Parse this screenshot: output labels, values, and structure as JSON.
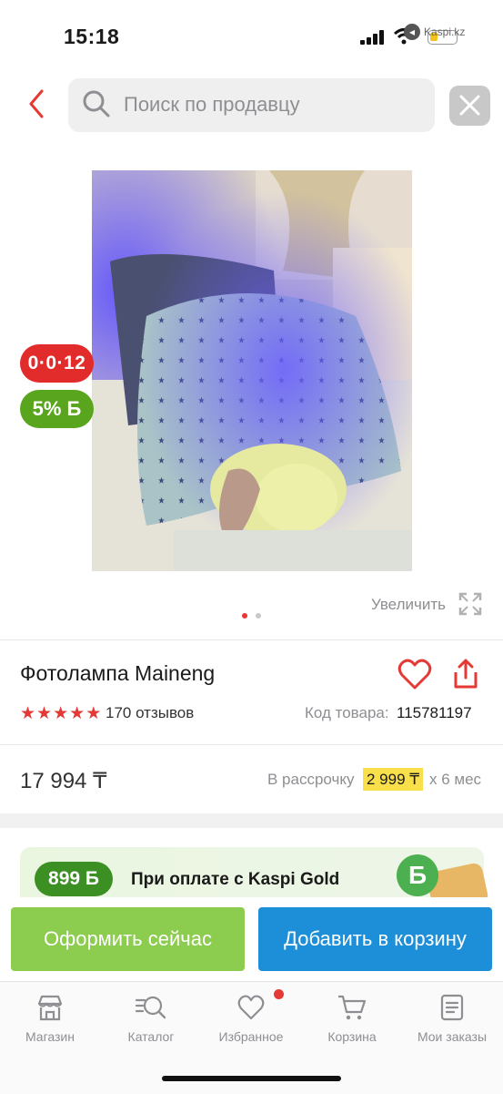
{
  "status_bar": {
    "time": "15:18",
    "source_tag": "Kaspi.kz"
  },
  "search": {
    "placeholder": "Поиск по продавцу"
  },
  "badges": {
    "timer": "0·0·12",
    "bonus": "5% Б"
  },
  "gallery": {
    "enlarge_label": "Увеличить",
    "current_slide": 1,
    "total_slides": 2
  },
  "product": {
    "title": "Фотолампа Maineng",
    "rating": 5,
    "reviews": "170 отзывов",
    "sku_label": "Код товара:",
    "sku_value": "115781197"
  },
  "pricing": {
    "price": "17 994 ₸",
    "installment_label": "В рассрочку",
    "installment_amount": "2 999 ₸",
    "installment_term": "х 6 мес"
  },
  "kaspi_gold": {
    "bonus": "899 Б",
    "text": "При оплате с Kaspi Gold",
    "coin": "Б"
  },
  "actions": {
    "buy_now": "Оформить сейчас",
    "add_to_cart": "Добавить в корзину"
  },
  "tabs": [
    {
      "label": "Магазин",
      "icon": "shop-icon"
    },
    {
      "label": "Каталог",
      "icon": "catalog-search-icon"
    },
    {
      "label": "Избранное",
      "icon": "heart-icon",
      "has_notification": true
    },
    {
      "label": "Корзина",
      "icon": "cart-icon"
    },
    {
      "label": "Мои заказы",
      "icon": "orders-icon"
    }
  ],
  "colors": {
    "brand_red": "#e53935",
    "green": "#8ccc4e",
    "blue": "#1c8fd8",
    "highlight": "#f9e04b"
  }
}
